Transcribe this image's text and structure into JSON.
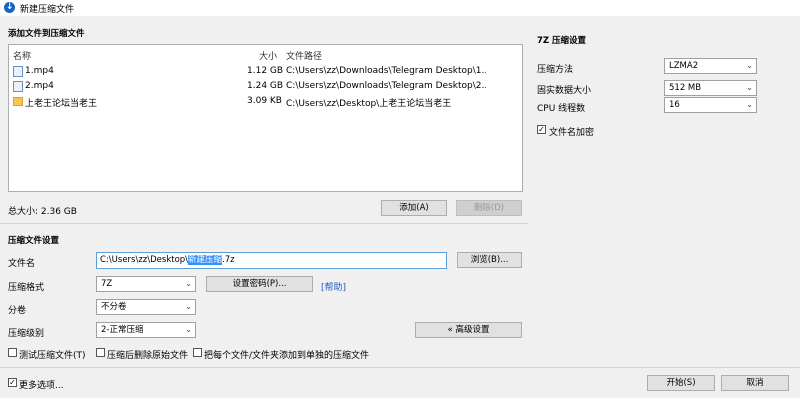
{
  "window": {
    "title": "新建压缩文件"
  },
  "files_section": {
    "title": "添加文件到压缩文件",
    "columns": {
      "name": "名称",
      "size": "大小",
      "path": "文件路径"
    },
    "rows": [
      {
        "name": "1.mp4",
        "size": "1.12 GB",
        "path": "C:\\Users\\zz\\Downloads\\Telegram Desktop\\1....",
        "type": "file"
      },
      {
        "name": "2.mp4",
        "size": "1.24 GB",
        "path": "C:\\Users\\zz\\Downloads\\Telegram Desktop\\2....",
        "type": "file"
      },
      {
        "name": "上老王论坛当老王",
        "size": "3.09 KB",
        "path": "C:\\Users\\zz\\Desktop\\上老王论坛当老王",
        "type": "folder"
      }
    ],
    "total": "总大小: 2.36 GB",
    "add_button": "添加(A)",
    "delete_button": "删除(D)"
  },
  "settings": {
    "title": "压缩文件设置",
    "filename_label": "文件名",
    "filename_prefix": "C:\\Users\\zz\\Desktop\\",
    "filename_selected": "新建压缩",
    "filename_suffix": ".7z",
    "browse_button": "浏览(B)...",
    "format_label": "压缩格式",
    "format_value": "7Z",
    "password_button": "设置密码(P)...",
    "help_link": "[帮助]",
    "volume_label": "分卷",
    "volume_value": "不分卷",
    "level_label": "压缩级别",
    "level_value": "2-正常压缩",
    "advanced_button": "« 高级设置",
    "test_checkbox": "测试压缩文件(T)",
    "delete_source_checkbox": "压缩后删除原始文件",
    "separate_checkbox": "把每个文件/文件夹添加到单独的压缩文件"
  },
  "seven_z": {
    "title": "7Z 压缩设置",
    "method_label": "压缩方法",
    "method_value": "LZMA2",
    "solid_label": "固实数据大小",
    "solid_value": "512 MB",
    "threads_label": "CPU 线程数",
    "threads_value": "16",
    "encrypt_names_label": "文件名加密"
  },
  "footer": {
    "more_options": "更多选项...",
    "start_button": "开始(S)",
    "cancel_button": "取消"
  }
}
